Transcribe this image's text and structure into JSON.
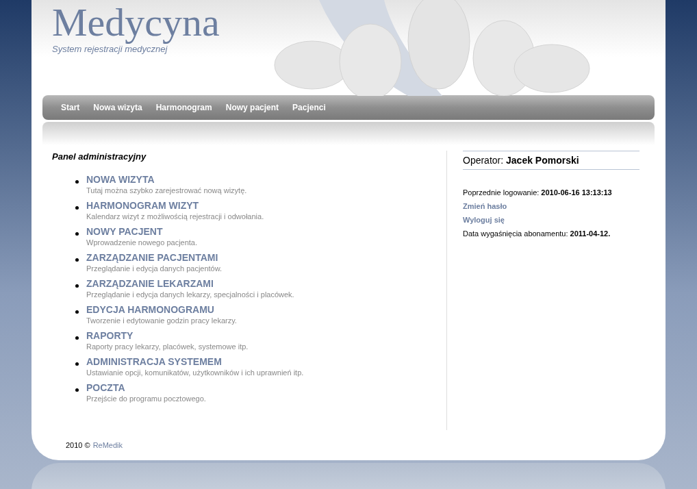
{
  "header": {
    "title": "Medycyna",
    "subtitle": "System rejestracji medycznej"
  },
  "nav": [
    {
      "label": "Start"
    },
    {
      "label": "Nowa wizyta"
    },
    {
      "label": "Harmonogram"
    },
    {
      "label": "Nowy pacjent"
    },
    {
      "label": "Pacjenci"
    }
  ],
  "main": {
    "heading": "Panel administracyjny",
    "items": [
      {
        "title": "NOWA WIZYTA",
        "description": "Tutaj można szybko zarejestrować nową wizytę."
      },
      {
        "title": "HARMONOGRAM WIZYT",
        "description": "Kalendarz wizyt z możliwością rejestracji i odwołania."
      },
      {
        "title": "NOWY PACJENT",
        "description": "Wprowadzenie nowego pacjenta."
      },
      {
        "title": "ZARZĄDZANIE PACJENTAMI",
        "description": "Przeglądanie i edycja danych pacjentów."
      },
      {
        "title": "ZARZĄDZANIE LEKARZAMI",
        "description": "Przeglądanie i edycja danych lekarzy, specjalności i placówek."
      },
      {
        "title": "EDYCJA HARMONOGRAMU",
        "description": "Tworzenie i edytowanie godzin pracy lekarzy."
      },
      {
        "title": "RAPORTY",
        "description": "Raporty pracy lekarzy, placówek, systemowe itp."
      },
      {
        "title": "ADMINISTRACJA SYSTEMEM",
        "description": "Ustawianie opcji, komunikatów, użytkowników i ich uprawnień itp."
      },
      {
        "title": "POCZTA",
        "description": "Przejście do programu pocztowego."
      }
    ]
  },
  "sidebar": {
    "operator": "Operator: **Jacek Pomorski**",
    "last_login": "Poprzednie logowanie: **2010-06-16 13:13:13**",
    "links": [
      "Zmień hasło",
      "Wyloguj się"
    ],
    "expiry": "Data wygaśnięcia abonamentu: **2011-04-12.**"
  },
  "footer": {
    "copyright": "2010 ©",
    "link": "ReMedik"
  }
}
